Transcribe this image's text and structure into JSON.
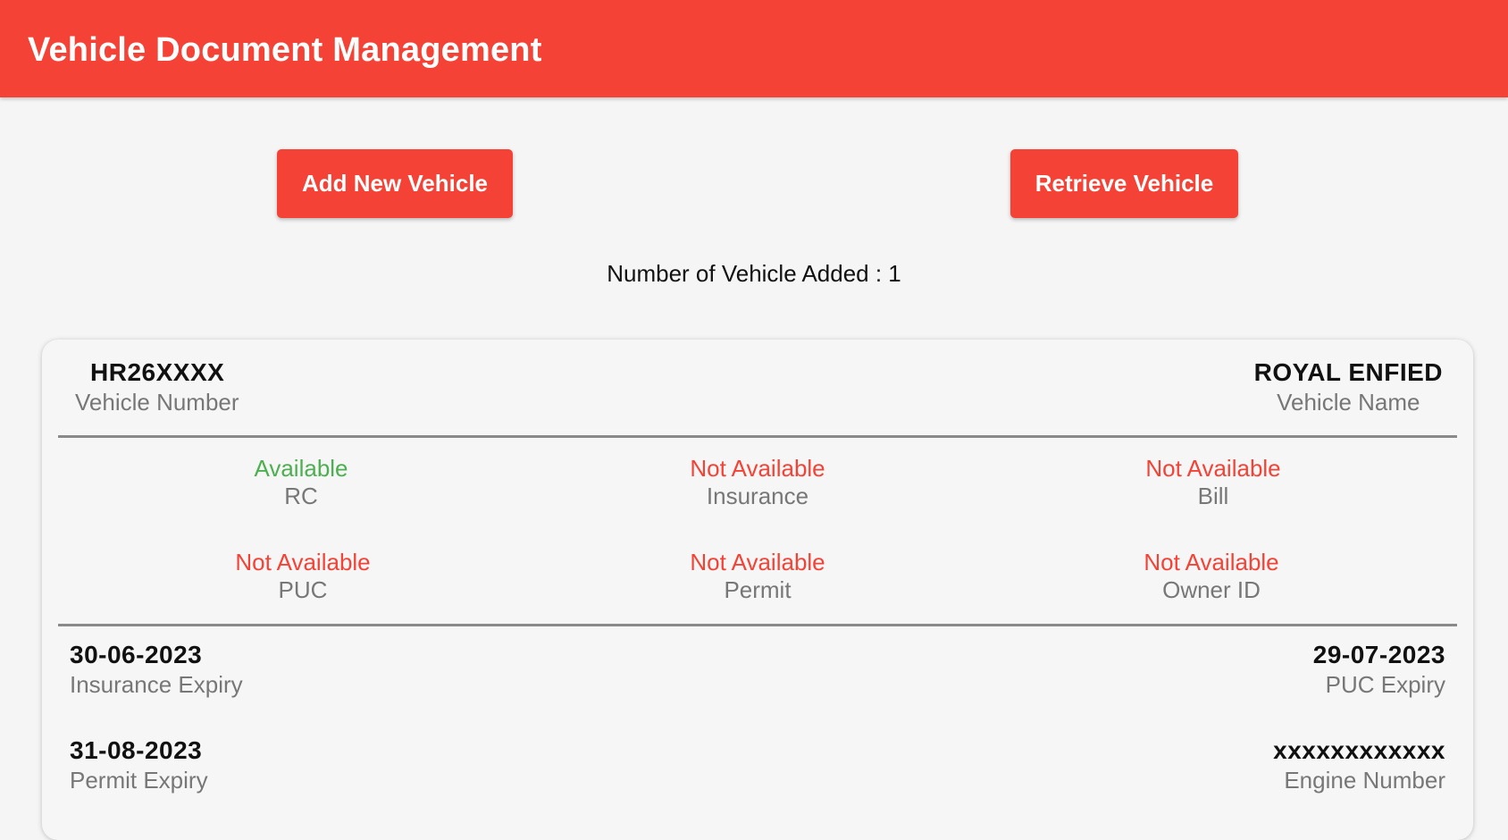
{
  "appbar": {
    "title": "Vehicle Document Management"
  },
  "actions": {
    "add_label": "Add New Vehicle",
    "retrieve_label": "Retrieve Vehicle"
  },
  "summary": {
    "count_text": "Number of Vehicle Added : 1"
  },
  "vehicle": {
    "number": {
      "value": "HR26XXXX",
      "label": "Vehicle Number"
    },
    "name": {
      "value": "ROYAL ENFIED",
      "label": "Vehicle Name"
    },
    "documents": [
      {
        "status": "Available",
        "name": "RC",
        "status_color": "#4caf50"
      },
      {
        "status": "Not Available",
        "name": "Insurance",
        "status_color": "#f44336"
      },
      {
        "status": "Not Available",
        "name": "Bill",
        "status_color": "#f44336"
      },
      {
        "status": "Not Available",
        "name": "PUC",
        "status_color": "#f44336"
      },
      {
        "status": "Not Available",
        "name": "Permit",
        "status_color": "#f44336"
      },
      {
        "status": "Not Available",
        "name": "Owner ID",
        "status_color": "#f44336"
      }
    ],
    "insurance_expiry": {
      "value": "30-06-2023",
      "label": "Insurance Expiry"
    },
    "puc_expiry": {
      "value": "29-07-2023",
      "label": "PUC Expiry"
    },
    "permit_expiry": {
      "value": "31-08-2023",
      "label": "Permit Expiry"
    },
    "engine_number": {
      "value": "xxxxxxxxxxxx",
      "label": "Engine Number"
    }
  },
  "colors": {
    "accent": "#f44336",
    "available": "#4caf50",
    "not_available": "#f44336"
  }
}
